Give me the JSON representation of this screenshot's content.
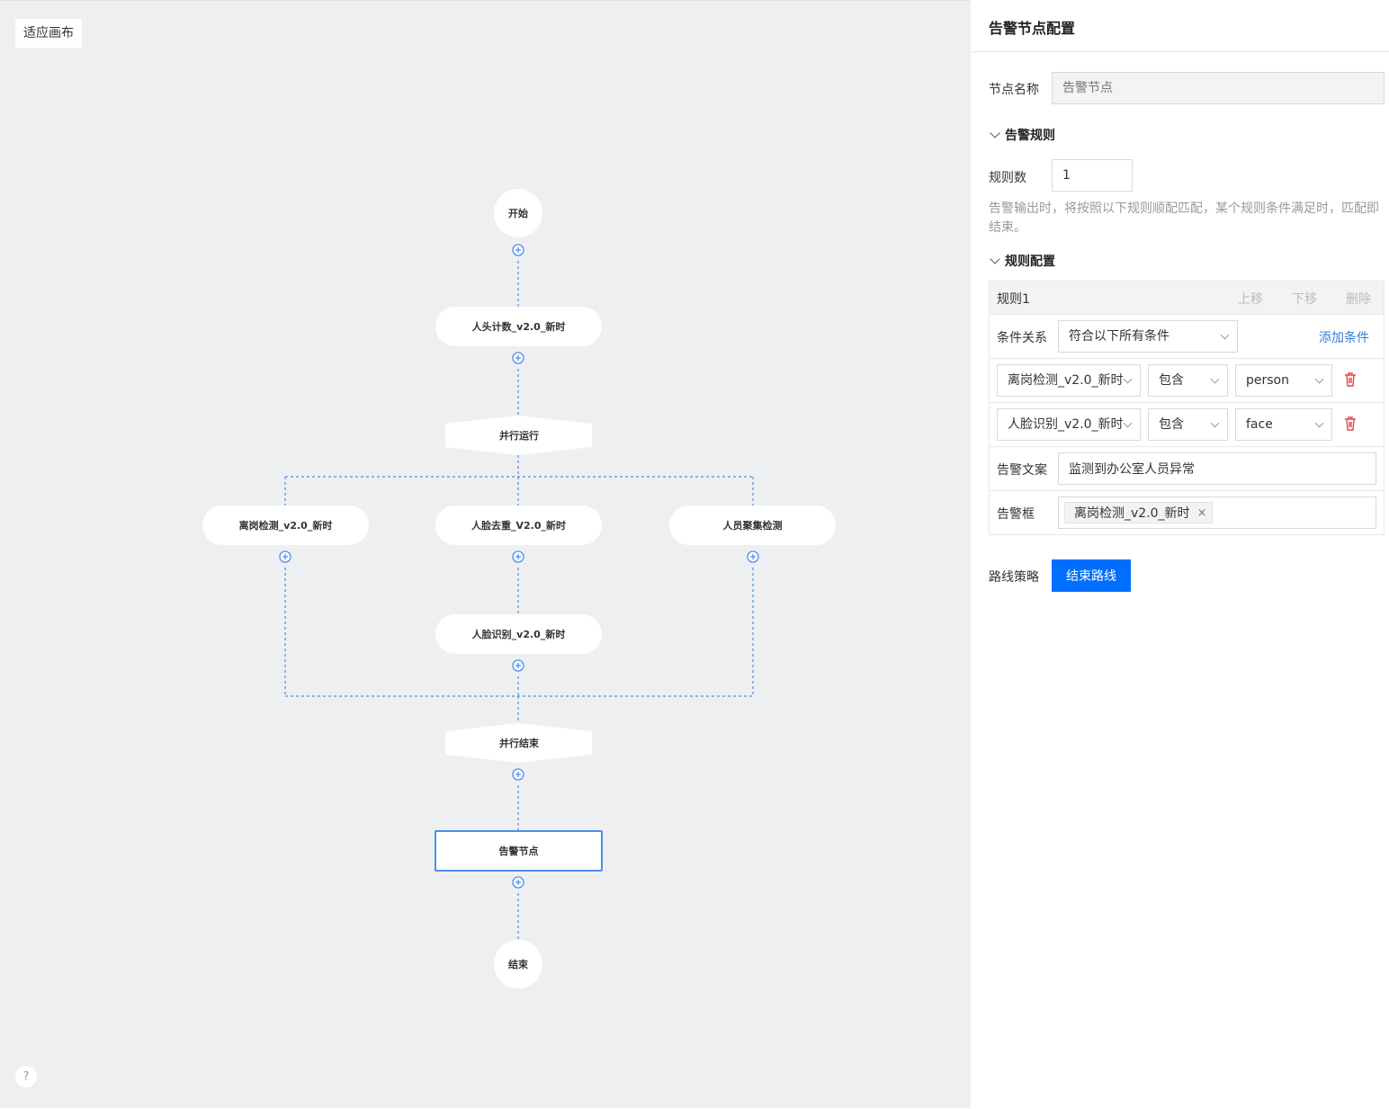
{
  "canvas": {
    "fit_button": "适应画布",
    "help": "?",
    "nodes": {
      "start": "开始",
      "head_count": "人头计数_v2.0_新时",
      "parallel_run": "并行运行",
      "leave_post": "离岗检测_v2.0_新时",
      "face_dedup": "人脸去重_V2.0_新时",
      "crowd": "人员聚集检测",
      "face_recog": "人脸识别_v2.0_新时",
      "parallel_end": "并行结束",
      "alarm": "告警节点",
      "end": "结束"
    },
    "colors": {
      "background": "#eeeff1",
      "edge": "#4a8ef0",
      "selected": "#4a8ef0"
    }
  },
  "panel": {
    "title": "告警节点配置",
    "node_name": {
      "label": "节点名称",
      "placeholder": "告警节点"
    },
    "alarm_rules": {
      "header": "告警规则",
      "rule_count_label": "规则数",
      "rule_count_value": "1",
      "hint": "告警输出时，将按照以下规则顺配匹配，某个规则条件满足时，匹配即结束。"
    },
    "rule_config": {
      "header": "规则配置",
      "rule": {
        "name": "规则1",
        "move_up": "上移",
        "move_down": "下移",
        "delete": "删除",
        "condition_relation_label": "条件关系",
        "condition_relation_value": "符合以下所有条件",
        "add_condition": "添加条件",
        "conditions": [
          {
            "source": "离岗检测_v2.0_新时",
            "operator": "包含",
            "value": "person"
          },
          {
            "source": "人脸识别_v2.0_新时",
            "operator": "包含",
            "value": "face"
          }
        ],
        "alarm_text_label": "告警文案",
        "alarm_text_value": "监测到办公室人员异常",
        "alarm_box_label": "告警框",
        "alarm_box_tag": "离岗检测_v2.0_新时"
      }
    },
    "route": {
      "label": "路线策略",
      "button": "结束路线"
    },
    "colors": {
      "primary": "#006eff",
      "link": "#2f7ed8",
      "danger": "#e54545",
      "muted": "#bbbbbb"
    }
  }
}
